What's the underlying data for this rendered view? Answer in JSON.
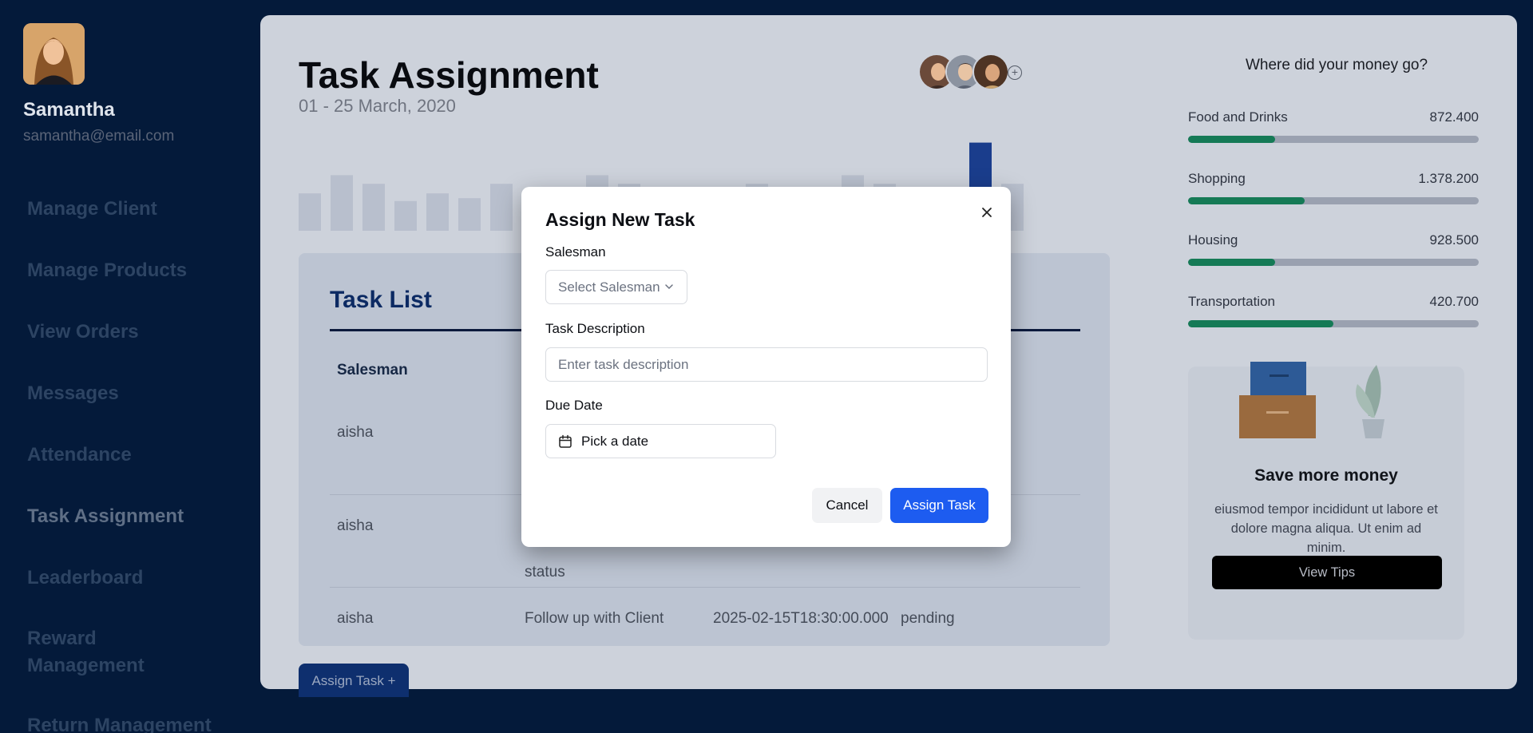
{
  "user": {
    "name": "Samantha",
    "email": "samantha@email.com"
  },
  "nav": {
    "items": [
      {
        "label": "Manage Client"
      },
      {
        "label": "Manage Products"
      },
      {
        "label": "View Orders"
      },
      {
        "label": "Messages"
      },
      {
        "label": "Attendance"
      },
      {
        "label": "Task Assignment",
        "active": true
      },
      {
        "label": "Leaderboard"
      },
      {
        "label": "Reward Management"
      },
      {
        "label": "Return Management"
      }
    ]
  },
  "header": {
    "title": "Task Assignment",
    "date_range": "01 - 25 March, 2020"
  },
  "activity_bars": {
    "values": [
      0.39,
      0.58,
      0.49,
      0.31,
      0.39,
      0.34,
      0.49,
      0.15,
      0.24,
      0.58,
      0.49,
      0.17,
      0.24,
      0.22,
      0.49,
      0.2,
      0.24,
      0.58,
      0.49,
      0.17,
      0.24,
      0.92,
      0.49
    ],
    "highlight_index": 21,
    "bar_color": "#b8bfcd",
    "highlight_color": "#1a3d8c"
  },
  "task_list": {
    "title": "Task List",
    "columns": [
      "Salesman"
    ],
    "rows": [
      {
        "salesman": "aisha",
        "description": "",
        "due": "",
        "status": ""
      },
      {
        "salesman": "aisha",
        "description": "status",
        "due": "",
        "status": ""
      },
      {
        "salesman": "aisha",
        "description": "Follow up with Client",
        "due": "2025-02-15T18:30:00.000",
        "status": "pending"
      }
    ]
  },
  "assign_tab_label": "Assign Task +",
  "expenses": {
    "title": "Where did your money go?",
    "items": [
      {
        "label": "Food and Drinks",
        "value": "872.400",
        "progress": 0.3
      },
      {
        "label": "Shopping",
        "value": "1.378.200",
        "progress": 0.4
      },
      {
        "label": "Housing",
        "value": "928.500",
        "progress": 0.3
      },
      {
        "label": "Transportation",
        "value": "420.700",
        "progress": 0.5
      }
    ],
    "fill_color": "#157a56"
  },
  "tips": {
    "title": "Save more money",
    "text": "eiusmod tempor incididunt ut labore et dolore magna aliqua. Ut enim ad minim.",
    "button": "View Tips"
  },
  "modal": {
    "title": "Assign New Task",
    "salesman_label": "Salesman",
    "salesman_placeholder": "Select Salesman",
    "description_label": "Task Description",
    "description_placeholder": "Enter task description",
    "due_label": "Due Date",
    "due_placeholder": "Pick a date",
    "cancel": "Cancel",
    "submit": "Assign Task",
    "accent": "#1d5cf0"
  }
}
